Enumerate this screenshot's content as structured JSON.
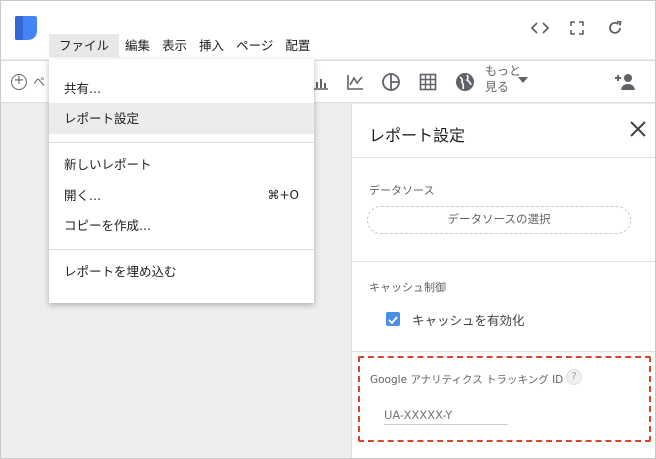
{
  "menubar": {
    "items": [
      "ファイル",
      "編集",
      "表示",
      "挿入",
      "ページ",
      "配置"
    ]
  },
  "header_icons": [
    "code-embed-icon",
    "fullscreen-icon",
    "refresh-icon"
  ],
  "toolbar": {
    "add_page_label": "ペ",
    "more_label": "もっと見る",
    "icons": [
      "bar-chart-icon",
      "line-chart-icon",
      "pie-chart-icon",
      "table-icon",
      "geo-map-icon",
      "add-person-icon"
    ]
  },
  "file_menu": {
    "share": "共有...",
    "report_settings": "レポート設定",
    "new_report": "新しいレポート",
    "open": "開く...",
    "open_shortcut": "⌘+O",
    "make_copy": "コピーを作成...",
    "embed": "レポートを埋め込む"
  },
  "panel": {
    "title": "レポート設定",
    "data_source_label": "データソース",
    "data_source_button": "データソースの選択",
    "cache_label": "キャッシュ制御",
    "cache_checkbox_label": "キャッシュを有効化",
    "cache_enabled": true,
    "ga_label": "Google アナリティクス トラッキング ID",
    "ga_help": "?",
    "ga_placeholder": "UA-XXXXX-Y",
    "ga_value": ""
  },
  "colors": {
    "accent": "#4a8fe7",
    "highlight_border": "#d9452b",
    "logo": "#4285f4"
  }
}
